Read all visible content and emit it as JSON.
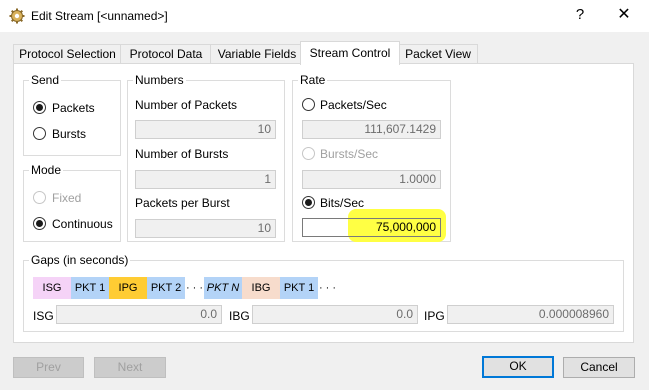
{
  "window": {
    "title": "Edit Stream [<unnamed>]",
    "help": "?",
    "close": "✕"
  },
  "tabs": [
    "Protocol Selection",
    "Protocol Data",
    "Variable Fields",
    "Stream Control",
    "Packet View"
  ],
  "send": {
    "title": "Send",
    "packets": "Packets",
    "bursts": "Bursts"
  },
  "mode": {
    "title": "Mode",
    "fixed": "Fixed",
    "continuous": "Continuous"
  },
  "numbers": {
    "title": "Numbers",
    "num_packets_label": "Number of Packets",
    "num_packets": "10",
    "num_bursts_label": "Number of Bursts",
    "num_bursts": "1",
    "ppb_label": "Packets per Burst",
    "ppb": "10"
  },
  "rate": {
    "title": "Rate",
    "pps_label": "Packets/Sec",
    "pps": "111,607.1429",
    "bps_label": "Bursts/Sec",
    "bps": "1.0000",
    "bits_label": "Bits/Sec",
    "bits": "75,000,000",
    "highlight_color": "#ffff44"
  },
  "gaps": {
    "title": "Gaps (in seconds)",
    "segments": [
      "ISG",
      "PKT 1",
      "IPG",
      "PKT 2",
      "· · ·",
      "PKT N",
      "IBG",
      "PKT 1",
      "· · ·"
    ],
    "segment_colors": {
      "isg": "#f5d3f7",
      "pkt": "#b3d3f7",
      "ipg": "#ffcc33",
      "ibg": "#f7dccc"
    },
    "isg_label": "ISG",
    "isg": "0.0",
    "ibg_label": "IBG",
    "ibg": "0.0",
    "ipg_label": "IPG",
    "ipg": "0.000008960"
  },
  "buttons": {
    "prev": "Prev",
    "next": "Next",
    "ok": "OK",
    "cancel": "Cancel"
  }
}
